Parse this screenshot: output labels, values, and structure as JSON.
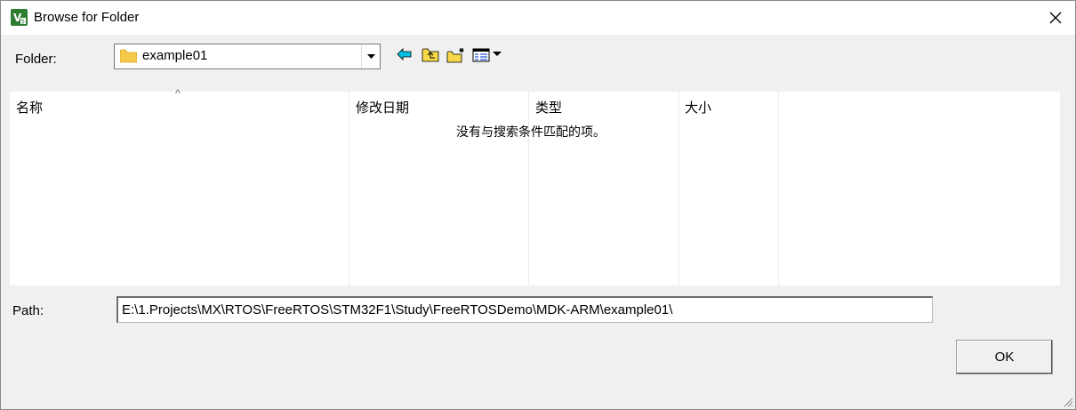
{
  "window": {
    "title": "Browse for Folder"
  },
  "icons": {
    "app": "keil-uvision-icon",
    "close": "close-icon",
    "folder": "folder-icon",
    "back": "back-icon",
    "up": "up-folder-icon",
    "new_folder": "new-folder-icon",
    "view_menu": "view-menu-icon"
  },
  "folder": {
    "label": "Folder:",
    "value": "example01"
  },
  "list": {
    "columns": [
      "名称",
      "修改日期",
      "类型",
      "大小"
    ],
    "empty_message": "没有与搜索条件匹配的项。"
  },
  "path": {
    "label": "Path:",
    "value": "E:\\1.Projects\\MX\\RTOS\\FreeRTOS\\STM32F1\\Study\\FreeRTOSDemo\\MDK-ARM\\example01\\"
  },
  "buttons": {
    "ok": "OK"
  },
  "colors": {
    "accent_cyan": "#00a0c8",
    "folder_yellow": "#f7c948",
    "icon_green": "#2e7d32"
  }
}
